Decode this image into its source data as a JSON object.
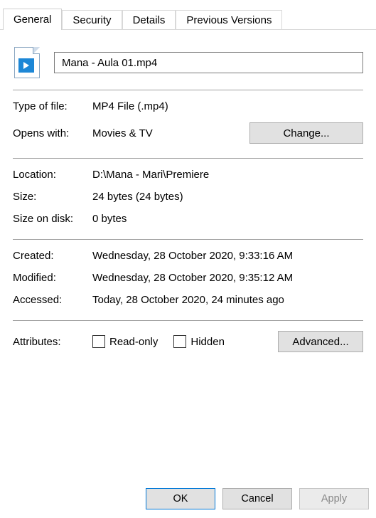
{
  "tabs": {
    "general": "General",
    "security": "Security",
    "details": "Details",
    "previous_versions": "Previous Versions"
  },
  "filename": "Mana - Aula 01.mp4",
  "type_of_file": {
    "label": "Type of file:",
    "value": "MP4 File (.mp4)"
  },
  "opens_with": {
    "label": "Opens with:",
    "value": "Movies & TV",
    "change": "Change..."
  },
  "location": {
    "label": "Location:",
    "value": "D:\\Mana - Mari\\Premiere"
  },
  "size": {
    "label": "Size:",
    "value": "24 bytes (24 bytes)"
  },
  "size_on_disk": {
    "label": "Size on disk:",
    "value": "0 bytes"
  },
  "created": {
    "label": "Created:",
    "value": "Wednesday, 28 October 2020, 9:33:16 AM"
  },
  "modified": {
    "label": "Modified:",
    "value": "Wednesday, 28 October 2020, 9:35:12 AM"
  },
  "accessed": {
    "label": "Accessed:",
    "value": "Today, 28 October 2020, 24 minutes ago"
  },
  "attributes": {
    "label": "Attributes:",
    "readonly": "Read-only",
    "hidden": "Hidden",
    "advanced": "Advanced..."
  },
  "buttons": {
    "ok": "OK",
    "cancel": "Cancel",
    "apply": "Apply"
  }
}
